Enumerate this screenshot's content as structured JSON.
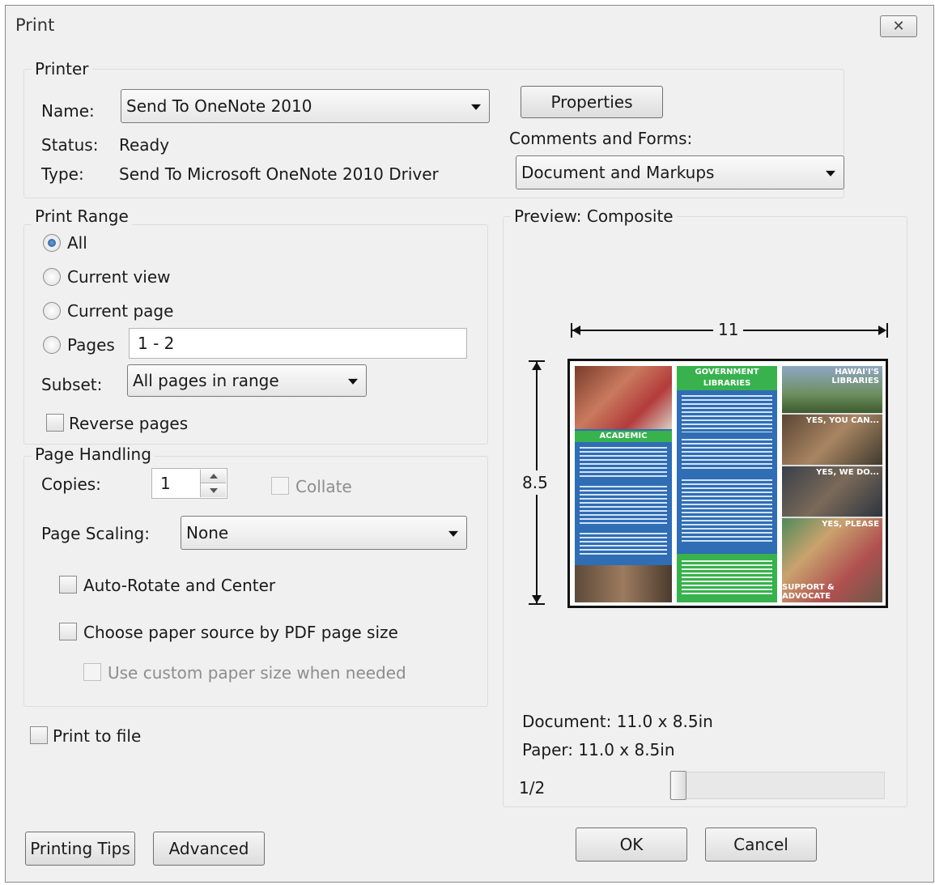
{
  "window": {
    "title": "Print",
    "close_glyph": "✕"
  },
  "printer": {
    "group_label": "Printer",
    "name_label": "Name:",
    "name_value": "Send To OneNote 2010",
    "status_label": "Status:",
    "status_value": "Ready",
    "type_label": "Type:",
    "type_value": "Send To Microsoft OneNote 2010 Driver",
    "properties_button": "Properties",
    "comments_label": "Comments and Forms:",
    "comments_value": "Document and Markups"
  },
  "print_range": {
    "group_label": "Print Range",
    "options": [
      {
        "label": "All",
        "selected": true
      },
      {
        "label": "Current view",
        "selected": false
      },
      {
        "label": "Current page",
        "selected": false
      },
      {
        "label": "Pages",
        "selected": false
      }
    ],
    "pages_value": "1 - 2",
    "subset_label": "Subset:",
    "subset_value": "All pages in range",
    "reverse_label": "Reverse pages"
  },
  "page_handling": {
    "group_label": "Page Handling",
    "copies_label": "Copies:",
    "copies_value": "1",
    "collate_label": "Collate",
    "scaling_label": "Page Scaling:",
    "scaling_value": "None",
    "auto_rotate_label": "Auto-Rotate and Center",
    "paper_source_label": "Choose paper source by PDF page size",
    "custom_paper_label": "Use custom paper size when needed"
  },
  "print_to_file_label": "Print to file",
  "preview": {
    "group_label": "Preview: Composite",
    "width_dim": "11",
    "height_dim": "8.5",
    "document_size": "Document: 11.0 x 8.5in",
    "paper_size": "Paper: 11.0 x 8.5in",
    "page_indicator": "1/2",
    "slider_position": 0.0,
    "thumbnail": {
      "col2_heading": "GOVERNMENT LIBRARIES",
      "col1_label": "ACADEMIC",
      "col3_labels": [
        "HAWAI'I'S LIBRARIES",
        "YES, YOU CAN...",
        "YES, WE DO...",
        "YES, PLEASE",
        "SUPPORT & ADVOCATE"
      ]
    }
  },
  "buttons": {
    "printing_tips": "Printing Tips",
    "advanced": "Advanced",
    "ok": "OK",
    "cancel": "Cancel"
  },
  "colors": {
    "accent_blue": "#2f6db5",
    "accent_green": "#37b24d"
  }
}
